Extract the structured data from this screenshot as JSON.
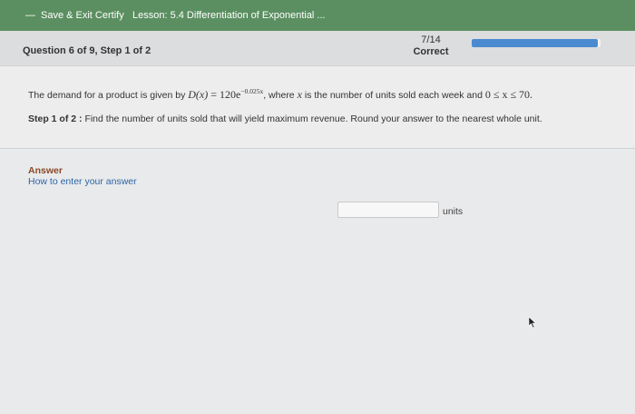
{
  "topbar": {
    "back_label": "Save & Exit Certify",
    "lesson": "Lesson: 5.4 Differentiation of Exponential ..."
  },
  "progress": {
    "question_label": "Question 6 of 9, Step 1 of 2",
    "score": "7/14",
    "status": "Correct",
    "fraction_complete": 0.98,
    "fill_color": "#4a8bd0"
  },
  "question": {
    "lead": "The demand for a product is given by ",
    "formula_lhs": "D(x)",
    "formula_eq": " = ",
    "formula_base": "120e",
    "formula_exp": "−0.025x",
    "mid": ", where ",
    "var": "x",
    "tail": " is the number of units sold each week and ",
    "range": "0 ≤ x ≤ 70.",
    "step_label": "Step 1 of 2 :",
    "step_text": "Find the number of units sold that will yield maximum revenue. Round your answer to the nearest whole unit."
  },
  "answer": {
    "label": "Answer",
    "help_link": "How to enter your answer",
    "value": "",
    "units": "units"
  }
}
